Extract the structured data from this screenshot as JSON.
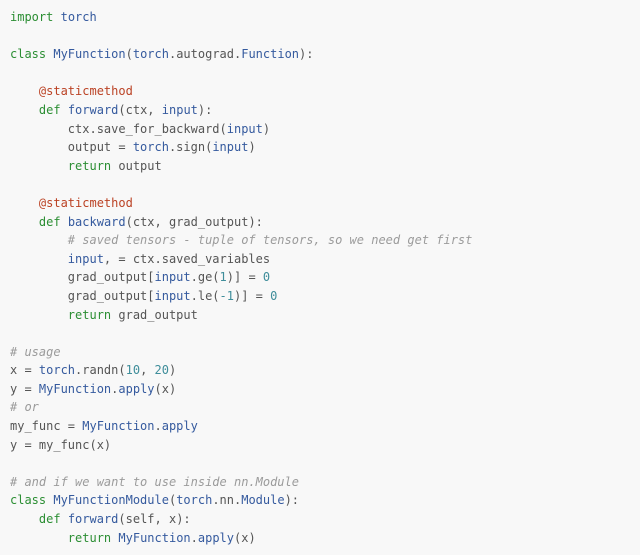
{
  "code": {
    "lines": [
      {
        "indent": 0,
        "segs": [
          {
            "cls": "kw",
            "t": "import"
          },
          {
            "cls": "pun",
            "t": " "
          },
          {
            "cls": "bi",
            "t": "torch"
          }
        ]
      },
      {
        "indent": 0,
        "segs": [
          {
            "cls": "pun",
            "t": " "
          }
        ]
      },
      {
        "indent": 0,
        "segs": [
          {
            "cls": "kw",
            "t": "class"
          },
          {
            "cls": "pun",
            "t": " "
          },
          {
            "cls": "nm",
            "t": "MyFunction"
          },
          {
            "cls": "pun",
            "t": "("
          },
          {
            "cls": "bi",
            "t": "torch"
          },
          {
            "cls": "pun",
            "t": ".autograd."
          },
          {
            "cls": "bi",
            "t": "Function"
          },
          {
            "cls": "pun",
            "t": "):"
          }
        ]
      },
      {
        "indent": 0,
        "segs": [
          {
            "cls": "pun",
            "t": " "
          }
        ]
      },
      {
        "indent": 1,
        "segs": [
          {
            "cls": "dec2",
            "t": "@staticmethod"
          }
        ]
      },
      {
        "indent": 1,
        "segs": [
          {
            "cls": "kw",
            "t": "def"
          },
          {
            "cls": "pun",
            "t": " "
          },
          {
            "cls": "fn",
            "t": "forward"
          },
          {
            "cls": "pun",
            "t": "(ctx, "
          },
          {
            "cls": "bi",
            "t": "input"
          },
          {
            "cls": "pun",
            "t": "):"
          }
        ]
      },
      {
        "indent": 2,
        "segs": [
          {
            "cls": "pun",
            "t": "ctx.save_for_backward("
          },
          {
            "cls": "bi",
            "t": "input"
          },
          {
            "cls": "pun",
            "t": ")"
          }
        ]
      },
      {
        "indent": 2,
        "segs": [
          {
            "cls": "pun",
            "t": "output = "
          },
          {
            "cls": "bi",
            "t": "torch"
          },
          {
            "cls": "pun",
            "t": ".sign("
          },
          {
            "cls": "bi",
            "t": "input"
          },
          {
            "cls": "pun",
            "t": ")"
          }
        ]
      },
      {
        "indent": 2,
        "segs": [
          {
            "cls": "kw",
            "t": "return"
          },
          {
            "cls": "pun",
            "t": " output"
          }
        ]
      },
      {
        "indent": 0,
        "segs": [
          {
            "cls": "pun",
            "t": " "
          }
        ]
      },
      {
        "indent": 1,
        "segs": [
          {
            "cls": "dec2",
            "t": "@staticmethod"
          }
        ]
      },
      {
        "indent": 1,
        "segs": [
          {
            "cls": "kw",
            "t": "def"
          },
          {
            "cls": "pun",
            "t": " "
          },
          {
            "cls": "fn",
            "t": "backward"
          },
          {
            "cls": "pun",
            "t": "(ctx, grad_output):"
          }
        ]
      },
      {
        "indent": 2,
        "segs": [
          {
            "cls": "cmt",
            "t": "# saved tensors - tuple of tensors, so we need get first"
          }
        ]
      },
      {
        "indent": 2,
        "segs": [
          {
            "cls": "bi",
            "t": "input"
          },
          {
            "cls": "pun",
            "t": ", = ctx.saved_variables"
          }
        ]
      },
      {
        "indent": 2,
        "segs": [
          {
            "cls": "pun",
            "t": "grad_output["
          },
          {
            "cls": "bi",
            "t": "input"
          },
          {
            "cls": "pun",
            "t": ".ge("
          },
          {
            "cls": "num",
            "t": "1"
          },
          {
            "cls": "pun",
            "t": ")] = "
          },
          {
            "cls": "num",
            "t": "0"
          }
        ]
      },
      {
        "indent": 2,
        "segs": [
          {
            "cls": "pun",
            "t": "grad_output["
          },
          {
            "cls": "bi",
            "t": "input"
          },
          {
            "cls": "pun",
            "t": ".le("
          },
          {
            "cls": "num",
            "t": "-1"
          },
          {
            "cls": "pun",
            "t": ")] = "
          },
          {
            "cls": "num",
            "t": "0"
          }
        ]
      },
      {
        "indent": 2,
        "segs": [
          {
            "cls": "kw",
            "t": "return"
          },
          {
            "cls": "pun",
            "t": " grad_output"
          }
        ]
      },
      {
        "indent": 0,
        "segs": [
          {
            "cls": "pun",
            "t": " "
          }
        ]
      },
      {
        "indent": 0,
        "segs": [
          {
            "cls": "cmt",
            "t": "# usage"
          }
        ]
      },
      {
        "indent": 0,
        "segs": [
          {
            "cls": "pun",
            "t": "x = "
          },
          {
            "cls": "bi",
            "t": "torch"
          },
          {
            "cls": "pun",
            "t": ".randn("
          },
          {
            "cls": "num",
            "t": "10"
          },
          {
            "cls": "pun",
            "t": ", "
          },
          {
            "cls": "num",
            "t": "20"
          },
          {
            "cls": "pun",
            "t": ")"
          }
        ]
      },
      {
        "indent": 0,
        "segs": [
          {
            "cls": "pun",
            "t": "y = "
          },
          {
            "cls": "nm",
            "t": "MyFunction"
          },
          {
            "cls": "pun",
            "t": "."
          },
          {
            "cls": "bi",
            "t": "apply"
          },
          {
            "cls": "pun",
            "t": "(x)"
          }
        ]
      },
      {
        "indent": 0,
        "segs": [
          {
            "cls": "cmt",
            "t": "# or"
          }
        ]
      },
      {
        "indent": 0,
        "segs": [
          {
            "cls": "pun",
            "t": "my_func = "
          },
          {
            "cls": "nm",
            "t": "MyFunction"
          },
          {
            "cls": "pun",
            "t": "."
          },
          {
            "cls": "bi",
            "t": "apply"
          }
        ]
      },
      {
        "indent": 0,
        "segs": [
          {
            "cls": "pun",
            "t": "y = my_func(x)"
          }
        ]
      },
      {
        "indent": 0,
        "segs": [
          {
            "cls": "pun",
            "t": " "
          }
        ]
      },
      {
        "indent": 0,
        "segs": [
          {
            "cls": "cmt",
            "t": "# and if we want to use inside nn.Module"
          }
        ]
      },
      {
        "indent": 0,
        "segs": [
          {
            "cls": "kw",
            "t": "class"
          },
          {
            "cls": "pun",
            "t": " "
          },
          {
            "cls": "nm",
            "t": "MyFunctionModule"
          },
          {
            "cls": "pun",
            "t": "("
          },
          {
            "cls": "bi",
            "t": "torch"
          },
          {
            "cls": "pun",
            "t": ".nn."
          },
          {
            "cls": "bi",
            "t": "Module"
          },
          {
            "cls": "pun",
            "t": "):"
          }
        ]
      },
      {
        "indent": 1,
        "segs": [
          {
            "cls": "kw",
            "t": "def"
          },
          {
            "cls": "pun",
            "t": " "
          },
          {
            "cls": "fn",
            "t": "forward"
          },
          {
            "cls": "pun",
            "t": "(self, x):"
          }
        ]
      },
      {
        "indent": 2,
        "segs": [
          {
            "cls": "kw",
            "t": "return"
          },
          {
            "cls": "pun",
            "t": " "
          },
          {
            "cls": "nm",
            "t": "MyFunction"
          },
          {
            "cls": "pun",
            "t": "."
          },
          {
            "cls": "bi",
            "t": "apply"
          },
          {
            "cls": "pun",
            "t": "(x)"
          }
        ]
      }
    ],
    "indent_unit": "    "
  }
}
